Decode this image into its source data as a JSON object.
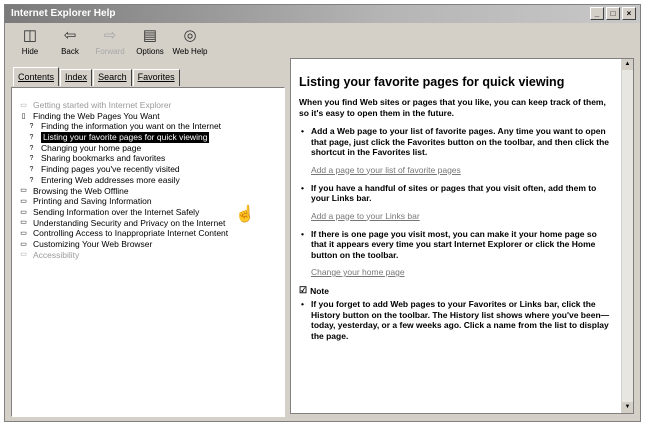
{
  "window": {
    "title": "Internet Explorer Help",
    "buttons": {
      "minimize": "_",
      "restore": "□",
      "close": "×"
    }
  },
  "toolbar": [
    {
      "label": "Hide",
      "icon": "hide-icon",
      "glyph": "◫",
      "disabled": false
    },
    {
      "label": "Back",
      "icon": "back-arrow-icon",
      "glyph": "⇦",
      "disabled": false
    },
    {
      "label": "Forward",
      "icon": "forward-arrow-icon",
      "glyph": "⇨",
      "disabled": true
    },
    {
      "label": "Options",
      "icon": "options-icon",
      "glyph": "▤",
      "disabled": false
    },
    {
      "label": "Web Help",
      "icon": "web-help-icon",
      "glyph": "◎",
      "disabled": false
    }
  ],
  "tabs": [
    {
      "label": "Contents",
      "active": true
    },
    {
      "label": "Index",
      "active": false
    },
    {
      "label": "Search",
      "active": false
    },
    {
      "label": "Favorites",
      "active": false
    }
  ],
  "tree": [
    {
      "label": "Getting started with Internet Explorer",
      "level": 0,
      "icon": "book-icon",
      "glyph": "▭",
      "muted": true,
      "selected": false
    },
    {
      "label": "Finding the Web Pages You Want",
      "level": 0,
      "icon": "open-book-icon",
      "glyph": "▯",
      "muted": false,
      "selected": false
    },
    {
      "label": "Finding the information you want on the Internet",
      "level": 1,
      "icon": "help-page-icon",
      "glyph": "?",
      "muted": false,
      "selected": false
    },
    {
      "label": "Listing your favorite pages for quick viewing",
      "level": 1,
      "icon": "help-page-icon",
      "glyph": "?",
      "muted": false,
      "selected": true
    },
    {
      "label": "Changing your home page",
      "level": 1,
      "icon": "help-page-icon",
      "glyph": "?",
      "muted": false,
      "selected": false
    },
    {
      "label": "Sharing bookmarks and favorites",
      "level": 1,
      "icon": "help-page-icon",
      "glyph": "?",
      "muted": false,
      "selected": false
    },
    {
      "label": "Finding pages you've recently visited",
      "level": 1,
      "icon": "help-page-icon",
      "glyph": "?",
      "muted": false,
      "selected": false
    },
    {
      "label": "Entering Web addresses more easily",
      "level": 1,
      "icon": "help-page-icon",
      "glyph": "?",
      "muted": false,
      "selected": false
    },
    {
      "label": "Browsing the Web Offline",
      "level": 0,
      "icon": "book-icon",
      "glyph": "▭",
      "muted": false,
      "selected": false
    },
    {
      "label": "Printing and Saving Information",
      "level": 0,
      "icon": "book-icon",
      "glyph": "▭",
      "muted": false,
      "selected": false
    },
    {
      "label": "Sending Information over the Internet Safely",
      "level": 0,
      "icon": "book-icon",
      "glyph": "▭",
      "muted": false,
      "selected": false
    },
    {
      "label": "Understanding Security and Privacy on the Internet",
      "level": 0,
      "icon": "book-icon",
      "glyph": "▭",
      "muted": false,
      "selected": false
    },
    {
      "label": "Controlling Access to Inappropriate Internet Content",
      "level": 0,
      "icon": "book-icon",
      "glyph": "▭",
      "muted": false,
      "selected": false
    },
    {
      "label": "Customizing Your Web Browser",
      "level": 0,
      "icon": "book-icon",
      "glyph": "▭",
      "muted": false,
      "selected": false
    },
    {
      "label": "Accessibility",
      "level": 0,
      "icon": "book-icon",
      "glyph": "▭",
      "muted": true,
      "selected": false
    }
  ],
  "content": {
    "title": "Listing your favorite pages for quick viewing",
    "intro": "When you find Web sites or pages that you like, you can keep track of them, so it's easy to open them in the future.",
    "bullets": [
      {
        "text": "Add a Web page to your list of favorite pages. Any time you want to open that page, just click the Favorites button on the toolbar, and then click the shortcut in the Favorites list.",
        "link": "Add a page to your list of favorite pages"
      },
      {
        "text": "If you have a handful of sites or pages that you visit often, add them to your Links bar.",
        "link": "Add a page to your Links bar"
      },
      {
        "text": "If there is one page you visit most, you can make it your home page so that it appears every time you start Internet Explorer or click the Home button on the toolbar.",
        "link": "Change your home page"
      }
    ],
    "note_label": "Note",
    "note_bullets": [
      {
        "text": "If you forget to add Web pages to your Favorites or Links bar, click the History button on the toolbar. The History list shows where you've been—today, yesterday, or a few weeks ago. Click a name from the list to display the page."
      }
    ]
  }
}
